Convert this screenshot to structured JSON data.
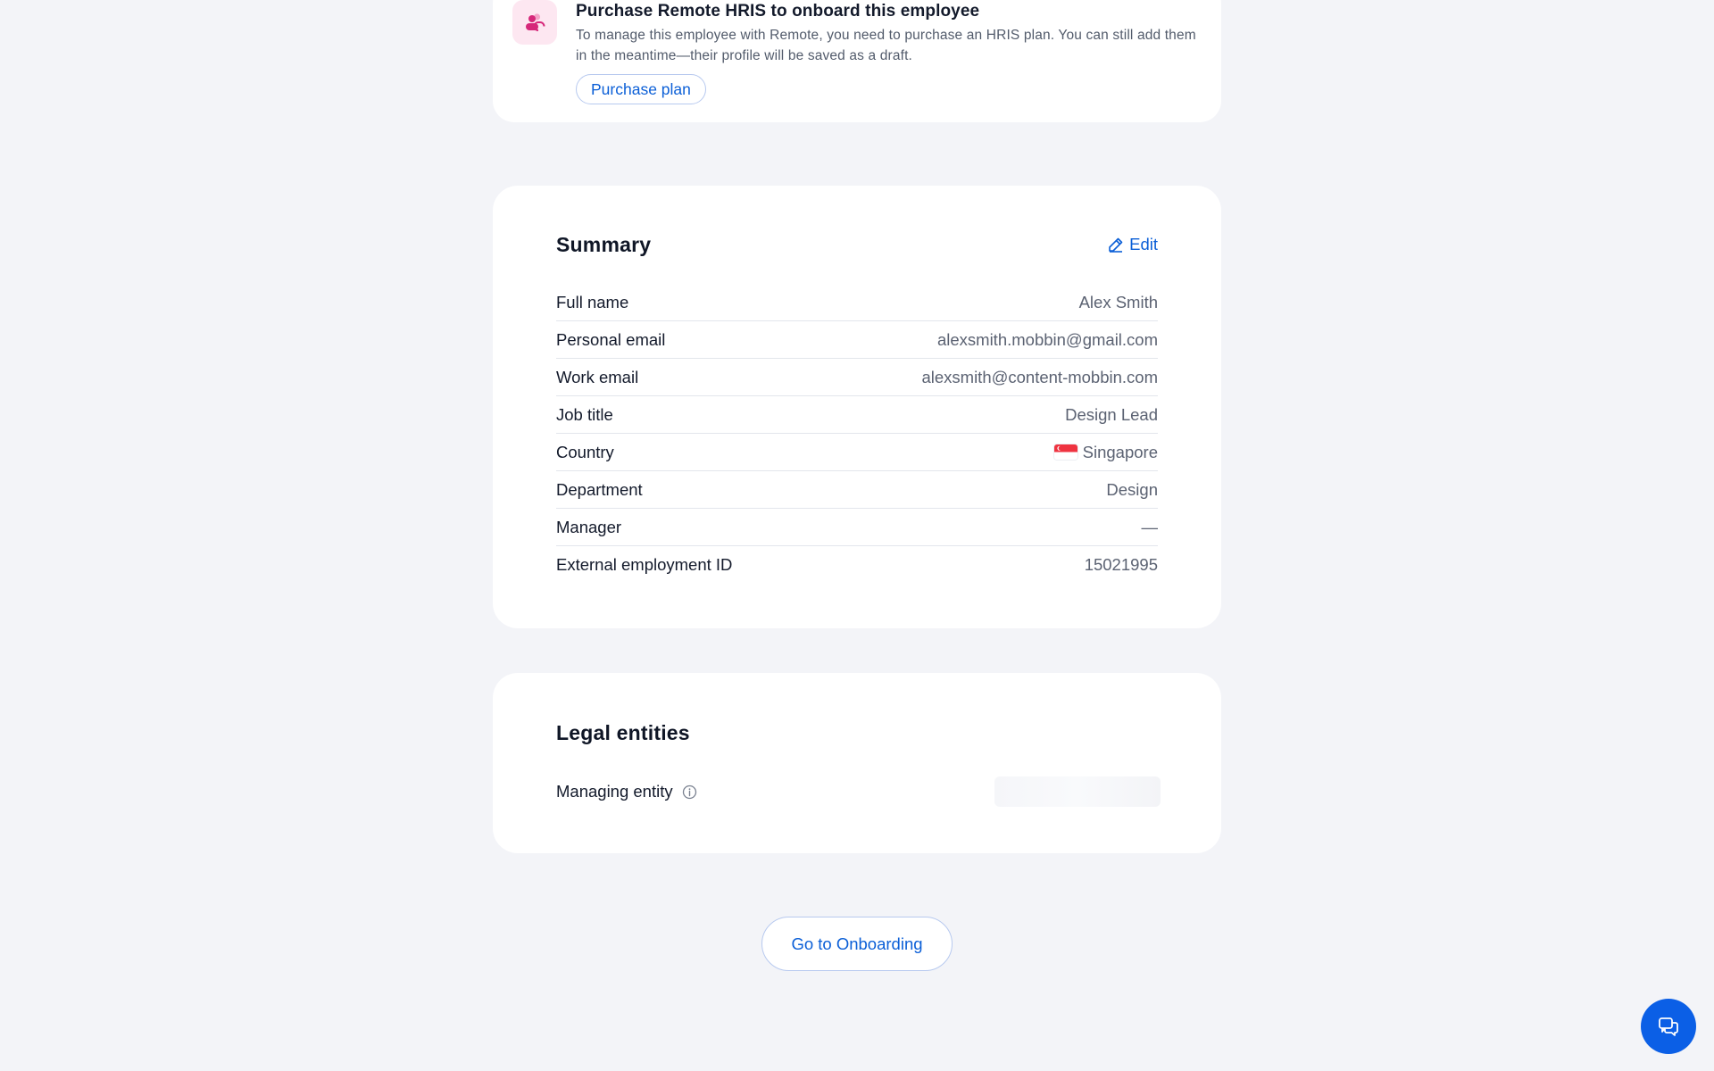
{
  "promo": {
    "title": "Purchase Remote HRIS to onboard this employee",
    "text": "To manage this employee with Remote, you need to purchase an HRIS plan. You can still add them in the meantime—their profile will be saved as a draft.",
    "button_label": "Purchase plan",
    "icon": "people-icon"
  },
  "summary": {
    "title": "Summary",
    "edit_label": "Edit",
    "rows": [
      {
        "label": "Full name",
        "value": "Alex Smith"
      },
      {
        "label": "Personal email",
        "value": "alexsmith.mobbin@gmail.com"
      },
      {
        "label": "Work email",
        "value": "alexsmith@content-mobbin.com"
      },
      {
        "label": "Job title",
        "value": "Design Lead"
      },
      {
        "label": "Country",
        "value": "Singapore",
        "icon": "singapore-flag-icon"
      },
      {
        "label": "Department",
        "value": "Design"
      },
      {
        "label": "Manager",
        "value": "—"
      },
      {
        "label": "External employment ID",
        "value": "15021995"
      }
    ]
  },
  "legal": {
    "title": "Legal entities",
    "managing_entity_label": "Managing entity"
  },
  "onboarding_button": "Go to Onboarding",
  "colors": {
    "background": "#f3f4f8",
    "accent": "#0b5fd7",
    "fab": "#0b5fe6",
    "promo_icon_bg": "#fde7f1",
    "promo_icon": "#d6287a"
  }
}
